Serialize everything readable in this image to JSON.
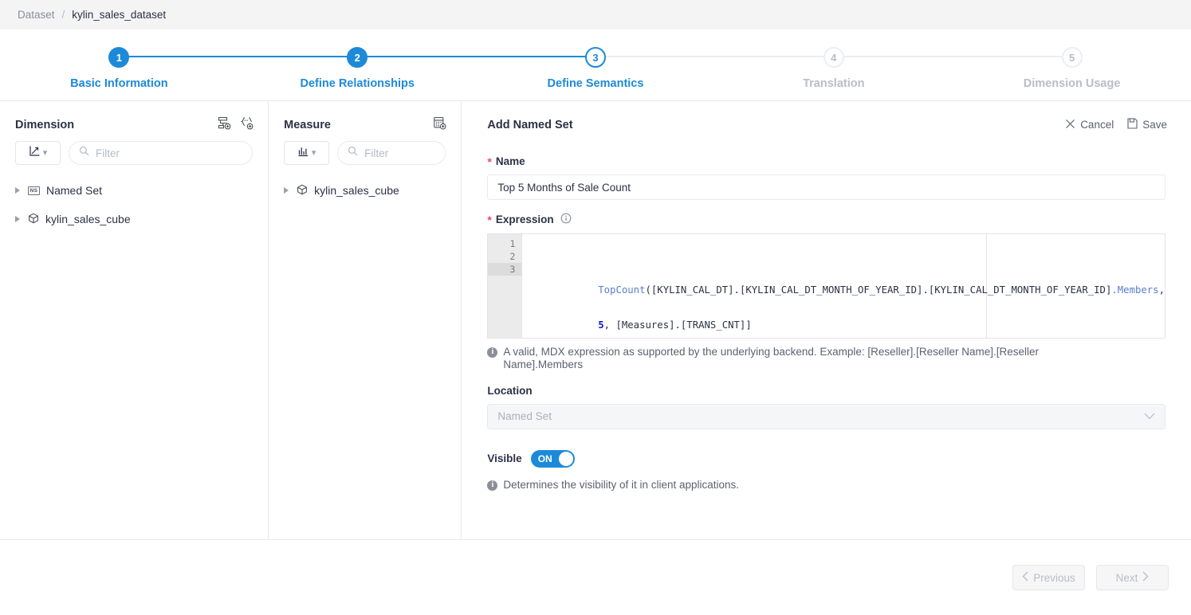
{
  "breadcrumb": {
    "root": "Dataset",
    "separator": "/",
    "current": "kylin_sales_dataset"
  },
  "stepper": {
    "steps": [
      {
        "num": "1",
        "label": "Basic Information",
        "state": "done"
      },
      {
        "num": "2",
        "label": "Define Relationships",
        "state": "done"
      },
      {
        "num": "3",
        "label": "Define Semantics",
        "state": "current"
      },
      {
        "num": "4",
        "label": "Translation",
        "state": "todo"
      },
      {
        "num": "5",
        "label": "Dimension Usage",
        "state": "todo"
      }
    ],
    "accent_color": "#1c8ad9",
    "inactive_color": "#b9bdc7"
  },
  "dimension_panel": {
    "title": "Dimension",
    "icons": [
      "add-hierarchy-icon",
      "add-named-set-icon"
    ],
    "type_select_icon": "axis-icon",
    "filter_placeholder": "Filter",
    "tree": [
      {
        "label": "Named Set",
        "icon": "named-set-badge-icon"
      },
      {
        "label": "kylin_sales_cube",
        "icon": "cube-icon"
      }
    ]
  },
  "measure_panel": {
    "title": "Measure",
    "icons": [
      "add-calculated-measure-icon"
    ],
    "type_select_icon": "bar-chart-icon",
    "filter_placeholder": "Filter",
    "tree": [
      {
        "label": "kylin_sales_cube",
        "icon": "cube-icon"
      }
    ]
  },
  "detail": {
    "title": "Add Named Set",
    "cancel_label": "Cancel",
    "save_label": "Save",
    "name": {
      "label": "Name",
      "required": true,
      "value": "Top 5 Months of Sale Count",
      "placeholder": ""
    },
    "expression": {
      "label": "Expression",
      "required": true,
      "info_icon": "info-icon",
      "line_numbers": [
        "1",
        "2",
        "3"
      ],
      "active_line": 3,
      "lines": [
        [
          {
            "t": "TopCount",
            "c": "kw"
          },
          {
            "t": "([KYLIN_CAL_DT].[KYLIN_CAL_DT_MONTH_OF_YEAR_ID].[KYLIN_CAL_DT_MONTH_OF_YEAR_ID]",
            "c": "plain"
          },
          {
            "t": ".Members",
            "c": "prop"
          },
          {
            "t": ",",
            "c": "plain"
          }
        ],
        [
          {
            "t": "5",
            "c": "num"
          },
          {
            "t": ", [Measures].[TRANS_CNT]]",
            "c": "plain"
          }
        ],
        [
          {
            "t": ")",
            "c": "plain"
          }
        ]
      ],
      "help": "A valid, MDX expression as supported by the underlying backend. Example: [Reseller].[Reseller Name].[Reseller Name].Members"
    },
    "location": {
      "label": "Location",
      "value": "Named Set",
      "disabled": true,
      "chevron": "chevron-down-icon"
    },
    "visible": {
      "label": "Visible",
      "state_label": "ON",
      "on": true,
      "help": "Determines the visibility of it in client applications."
    }
  },
  "footer": {
    "previous_label": "Previous",
    "next_label": "Next",
    "previous_disabled": true,
    "next_disabled": true
  }
}
